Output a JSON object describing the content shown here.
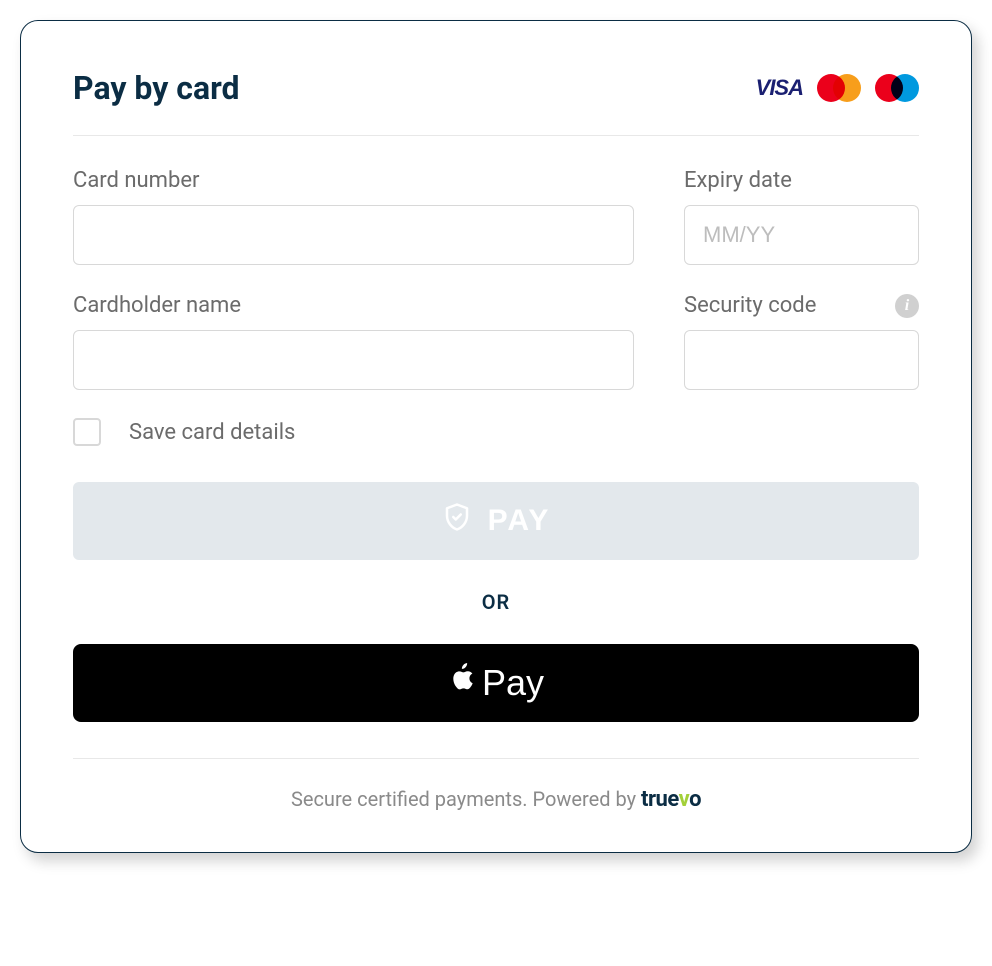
{
  "header": {
    "title": "Pay by card",
    "brands": [
      "visa",
      "mastercard",
      "maestro"
    ]
  },
  "fields": {
    "card_number": {
      "label": "Card number",
      "value": "",
      "placeholder": ""
    },
    "expiry": {
      "label": "Expiry date",
      "value": "",
      "placeholder": "MM/YY"
    },
    "cardholder": {
      "label": "Cardholder name",
      "value": "",
      "placeholder": ""
    },
    "security_code": {
      "label": "Security code",
      "value": "",
      "placeholder": ""
    }
  },
  "save_card": {
    "label": "Save card details",
    "checked": false
  },
  "buttons": {
    "pay_label": "PAY",
    "or_text": "OR",
    "apple_pay_label": "Pay"
  },
  "footer": {
    "text": "Secure certified payments. Powered by ",
    "brand": "truevo"
  }
}
